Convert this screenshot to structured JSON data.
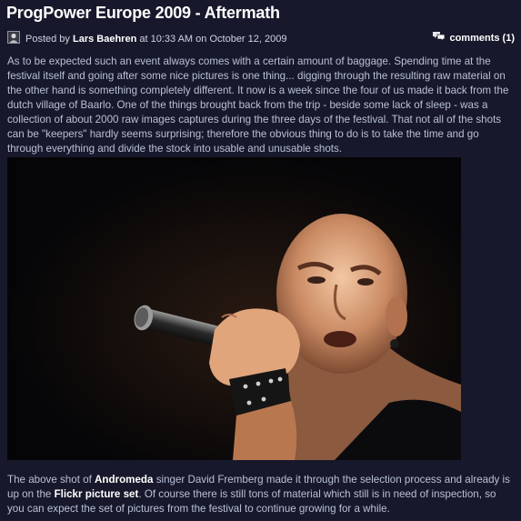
{
  "post": {
    "title": "ProgPower Europe 2009 - Aftermath",
    "posted_by_label": "Posted by",
    "author": "Lars Baehren",
    "at_label": "at",
    "time": "10:33 AM",
    "on_label": "on",
    "date": "October 12, 2009",
    "comments_label": "comments (1)",
    "paragraph": "As to be expected such an event always comes with a certain amount of baggage. Spending time at the festival itself and going after some nice pictures is one thing... digging through the resulting raw material on the other hand is something completely different. It now is a week since the four of us made it back from the dutch village of Baarlo. One of the things brought back from the trip - beside some lack of sleep - was a collection of about 2000 raw images captures during the three days of the festival. That not all of the shots can be \"keepers\" hardly seems surprising; therefore the obvious thing to do is to take the time and go through everything and divide the stock into usable and unusable shots."
  },
  "photo": {
    "icon": "concert-photo-singer-microphone"
  },
  "caption": {
    "part1": "The above shot of ",
    "link_andromeda": "Andromeda",
    "part2": " singer David Fremberg made it through the selection process and already is up on the ",
    "link_flickr": "Flickr picture set",
    "part3": ". Of course there is still tons of material which still is in need of inspection, so you can expect the set of pictures from the festival to continue growing for a while."
  },
  "colors": {
    "background": "#17182b",
    "text": "#b9c0d8",
    "title": "#ffffff",
    "link": "#ffffff"
  }
}
